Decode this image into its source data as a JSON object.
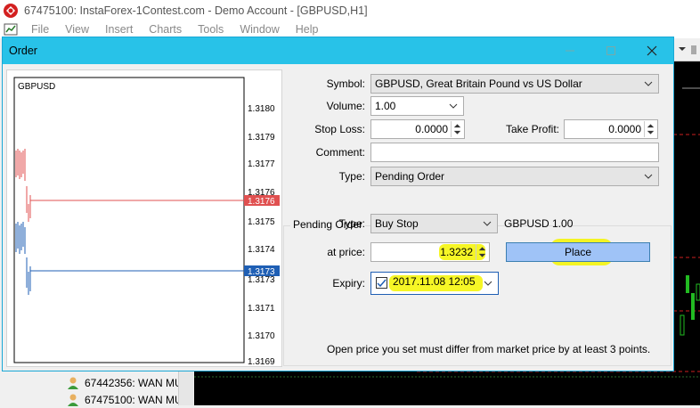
{
  "main_window": {
    "title": "67475100: InstaForex-1Contest.com - Demo Account - [GBPUSD,H1]",
    "menu": [
      "File",
      "View",
      "Insert",
      "Charts",
      "Tools",
      "Window",
      "Help"
    ]
  },
  "navigator": {
    "accounts": [
      "67442356: WAN MU",
      "67475100: WAN MU"
    ]
  },
  "dialog": {
    "title": "Order",
    "symbol_label": "Symbol:",
    "symbol_value": "GBPUSD, Great Britain Pound vs US Dollar",
    "volume_label": "Volume:",
    "volume_value": "1.00",
    "stop_loss_label": "Stop Loss:",
    "stop_loss_value": "0.0000",
    "take_profit_label": "Take Profit:",
    "take_profit_value": "0.0000",
    "comment_label": "Comment:",
    "comment_value": "",
    "type_label": "Type:",
    "type_value": "Pending Order",
    "pending": {
      "group_label": "Pending Order",
      "type_label": "Type:",
      "type_value": "Buy Stop",
      "summary": "GBPUSD 1.00",
      "price_label": "at price:",
      "price_value": "1.3232",
      "place_label": "Place",
      "expiry_label": "Expiry:",
      "expiry_value": "2017.11.08 12:05",
      "expiry_checked": true,
      "note": "Open price you set must differ from market price by at least 3 points."
    },
    "chart": {
      "symbol": "GBPUSD",
      "price_labels": [
        "1.3180",
        "1.3179",
        "1.3177",
        "1.3176",
        "1.3175",
        "1.3174",
        "1.3173",
        "1.3173",
        "1.3171",
        "1.3170",
        "1.3169"
      ],
      "bid_label": "1.3176",
      "ask_label": "1.3173",
      "bid_color": "#e05050",
      "ask_color": "#1f5fb4"
    }
  },
  "colors": {
    "dialog_titlebar": "#28c2e8",
    "highlight": "#f5f500",
    "place_button": "#9fc3f7"
  }
}
